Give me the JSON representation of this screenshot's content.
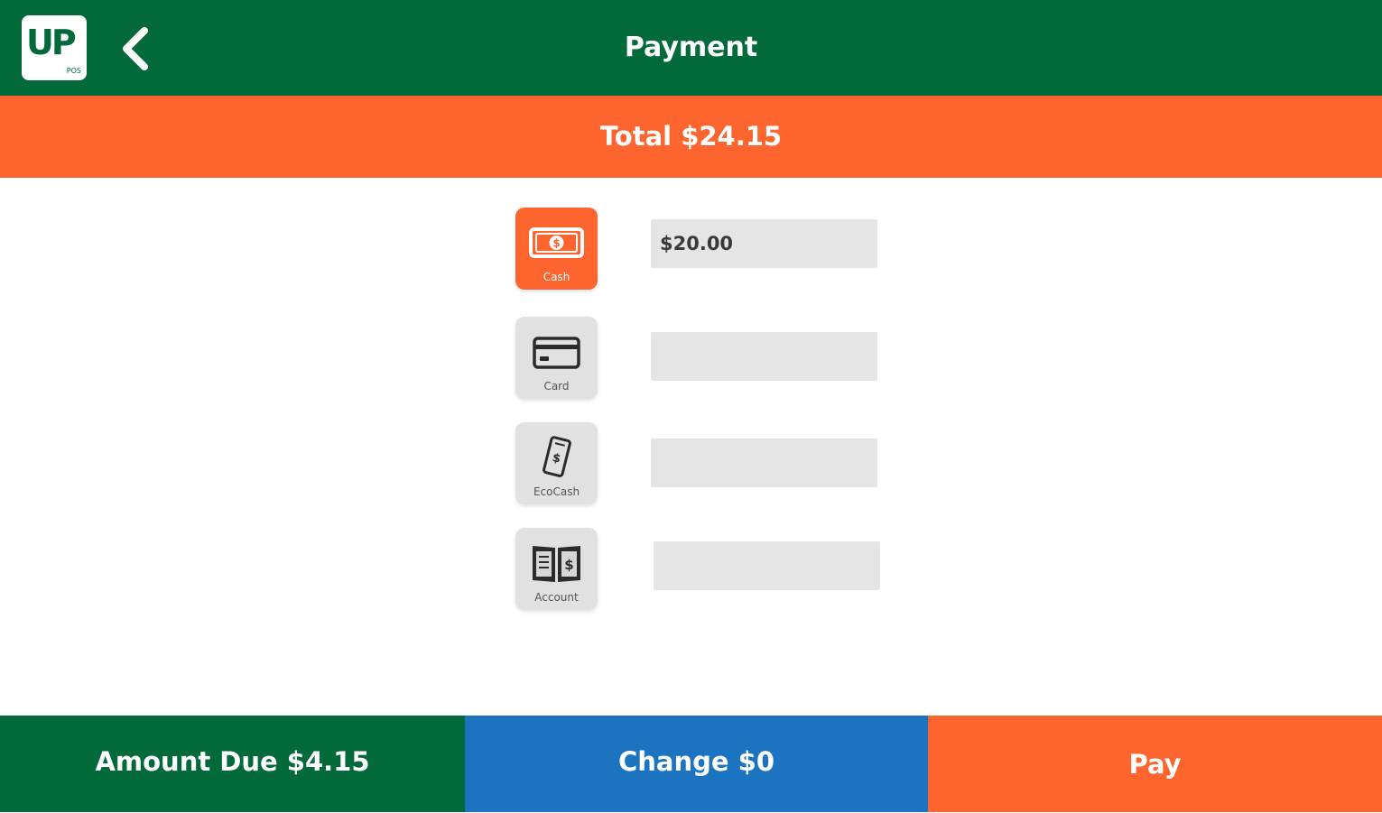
{
  "header": {
    "logo_text": "UP",
    "logo_subtext": "POS",
    "title": "Payment"
  },
  "total": {
    "label": "Total $24.15"
  },
  "payment_methods": [
    {
      "label": "Cash",
      "icon": "cash-icon",
      "value": "$20.00",
      "active": true
    },
    {
      "label": "Card",
      "icon": "credit-card-icon",
      "value": "",
      "active": false
    },
    {
      "label": "EcoCash",
      "icon": "mobile-money-icon",
      "value": "",
      "active": false
    },
    {
      "label": "Account",
      "icon": "account-book-icon",
      "value": "",
      "active": false
    }
  ],
  "footer": {
    "amount_due": "Amount Due $4.15",
    "change": "Change $0",
    "pay": "Pay"
  },
  "colors": {
    "header_green": "#01693a",
    "accent_orange": "#fe642e",
    "change_blue": "#1c73bf",
    "field_gray": "#e5e5e5",
    "button_gray": "#e1e1e1"
  }
}
